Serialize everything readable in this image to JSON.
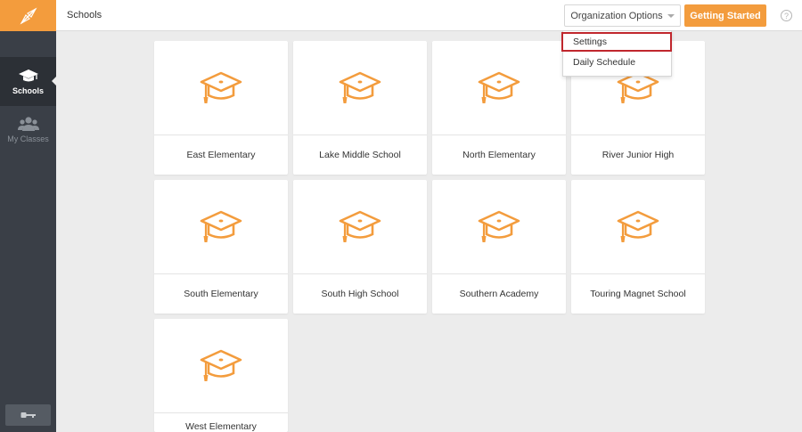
{
  "header": {
    "title": "Schools",
    "org_options_label": "Organization Options",
    "getting_started_label": "Getting Started",
    "help_glyph": "?"
  },
  "sidebar": {
    "items": [
      {
        "label": "Schools",
        "icon": "graduation-cap-icon",
        "active": true
      },
      {
        "label": "My Classes",
        "icon": "group-icon",
        "active": false
      }
    ],
    "logout_icon": "key-icon"
  },
  "dropdown": {
    "items": [
      {
        "label": "Settings",
        "highlighted": true
      },
      {
        "label": "Daily Schedule",
        "highlighted": false
      }
    ]
  },
  "schools": [
    {
      "name": "East Elementary"
    },
    {
      "name": "Lake Middle School"
    },
    {
      "name": "North Elementary"
    },
    {
      "name": "River Junior High"
    },
    {
      "name": "South Elementary"
    },
    {
      "name": "South High School"
    },
    {
      "name": "Southern Academy"
    },
    {
      "name": "Touring Magnet School"
    },
    {
      "name": "West Elementary"
    }
  ],
  "colors": {
    "accent": "#f39c3d",
    "sidebar": "#3a3f47",
    "highlight_border": "#c0272d"
  }
}
